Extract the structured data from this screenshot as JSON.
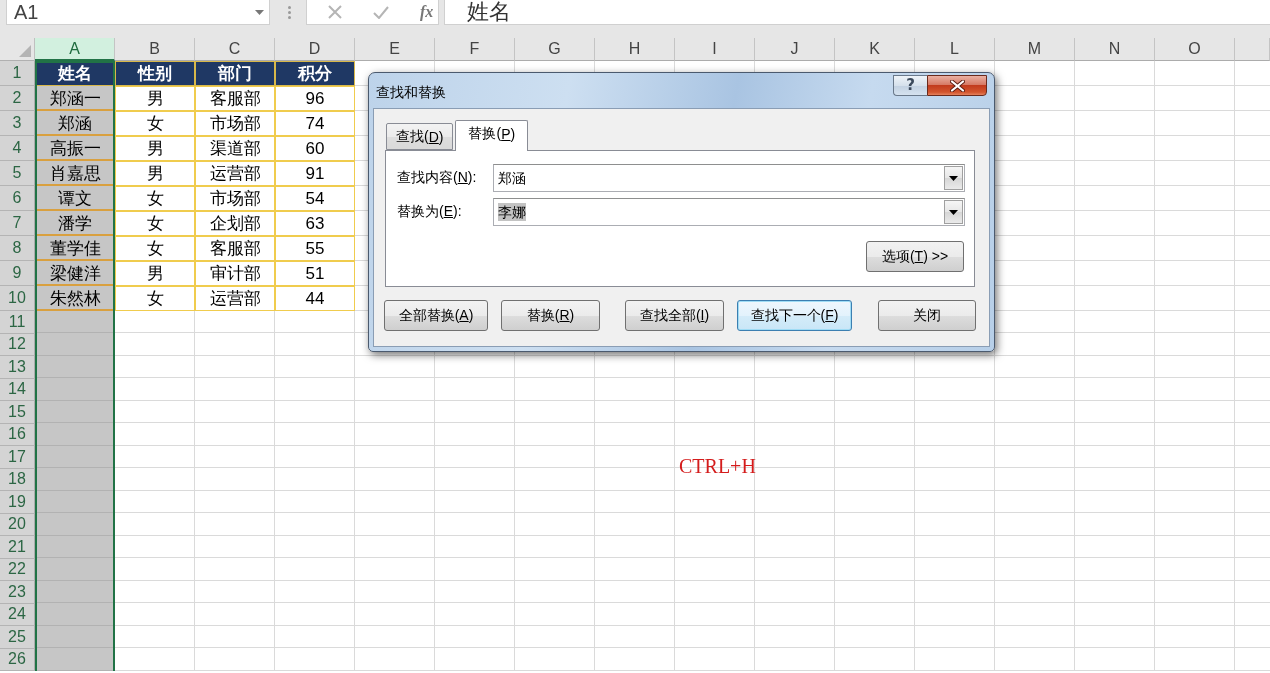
{
  "formula_bar": {
    "name_box": "A1",
    "function_label": "fx",
    "formula": "姓名"
  },
  "sheet": {
    "columns": [
      {
        "label": "A",
        "selected": true
      },
      {
        "label": "B",
        "selected": false
      },
      {
        "label": "C",
        "selected": false
      },
      {
        "label": "D",
        "selected": false
      },
      {
        "label": "E",
        "selected": false
      },
      {
        "label": "F",
        "selected": false
      },
      {
        "label": "G",
        "selected": false
      },
      {
        "label": "H",
        "selected": false
      },
      {
        "label": "I",
        "selected": false
      },
      {
        "label": "J",
        "selected": false
      },
      {
        "label": "K",
        "selected": false
      },
      {
        "label": "L",
        "selected": false
      },
      {
        "label": "M",
        "selected": false
      },
      {
        "label": "N",
        "selected": false
      },
      {
        "label": "O",
        "selected": false
      }
    ],
    "row_headers": [
      {
        "label": "1",
        "highlighted": true
      },
      {
        "label": "2",
        "highlighted": true
      },
      {
        "label": "3",
        "highlighted": true
      },
      {
        "label": "4",
        "highlighted": true
      },
      {
        "label": "5",
        "highlighted": true
      },
      {
        "label": "6",
        "highlighted": true
      },
      {
        "label": "7",
        "highlighted": true
      },
      {
        "label": "8",
        "highlighted": true
      },
      {
        "label": "9",
        "highlighted": true
      },
      {
        "label": "10",
        "highlighted": true
      },
      {
        "label": "11",
        "highlighted": true
      },
      {
        "label": "12",
        "highlighted": true
      },
      {
        "label": "13",
        "highlighted": true
      },
      {
        "label": "14",
        "highlighted": true
      },
      {
        "label": "15",
        "highlighted": true
      },
      {
        "label": "16",
        "highlighted": true
      },
      {
        "label": "17",
        "highlighted": true
      },
      {
        "label": "18",
        "highlighted": true
      },
      {
        "label": "19",
        "highlighted": true
      },
      {
        "label": "20",
        "highlighted": true
      },
      {
        "label": "21",
        "highlighted": true
      },
      {
        "label": "22",
        "highlighted": true
      },
      {
        "label": "23",
        "highlighted": true
      },
      {
        "label": "24",
        "highlighted": true
      },
      {
        "label": "25",
        "highlighted": true
      },
      {
        "label": "26",
        "highlighted": true
      }
    ],
    "table": {
      "header": [
        "姓名",
        "性别",
        "部门",
        "积分"
      ],
      "rows": [
        [
          "郑涵一",
          "男",
          "客服部",
          "96"
        ],
        [
          "郑涵",
          "女",
          "市场部",
          "74"
        ],
        [
          "高振一",
          "男",
          "渠道部",
          "60"
        ],
        [
          "肖嘉思",
          "男",
          "运营部",
          "91"
        ],
        [
          "谭文",
          "女",
          "市场部",
          "54"
        ],
        [
          "潘学",
          "女",
          "企划部",
          "63"
        ],
        [
          "董学佳",
          "女",
          "客服部",
          "55"
        ],
        [
          "梁健洋",
          "男",
          "审计部",
          "51"
        ],
        [
          "朱然林",
          "女",
          "运营部",
          "44"
        ]
      ]
    },
    "annotation": "CTRL+H"
  },
  "dialog": {
    "title": "查找和替换",
    "help_button": "?",
    "tabs": [
      {
        "text": "查找(",
        "access_key": "D",
        "text_after": ")",
        "selected": false
      },
      {
        "text": "替换(",
        "access_key": "P",
        "text_after": ")",
        "selected": true
      }
    ],
    "fields": [
      {
        "text": "查找内容(",
        "access_key": "N",
        "text_after": "):",
        "value": "郑涵",
        "value_selected": false
      },
      {
        "text": "替换为(",
        "access_key": "E",
        "text_after": "):",
        "value": "李娜",
        "value_selected": true
      }
    ],
    "options_button": {
      "text": "选项(",
      "access_key": "T",
      "text_after": ") >>"
    },
    "buttons": [
      {
        "text": "全部替换(",
        "access_key": "A",
        "text_after": ")",
        "focused": false
      },
      {
        "text": "替换(",
        "access_key": "R",
        "text_after": ")",
        "focused": false
      },
      {
        "text": "查找全部(",
        "access_key": "I",
        "text_after": ")",
        "focused": false
      },
      {
        "text": "查找下一个(",
        "access_key": "F",
        "text_after": ")",
        "focused": true
      },
      {
        "text": "关闭",
        "focused": false
      }
    ]
  }
}
